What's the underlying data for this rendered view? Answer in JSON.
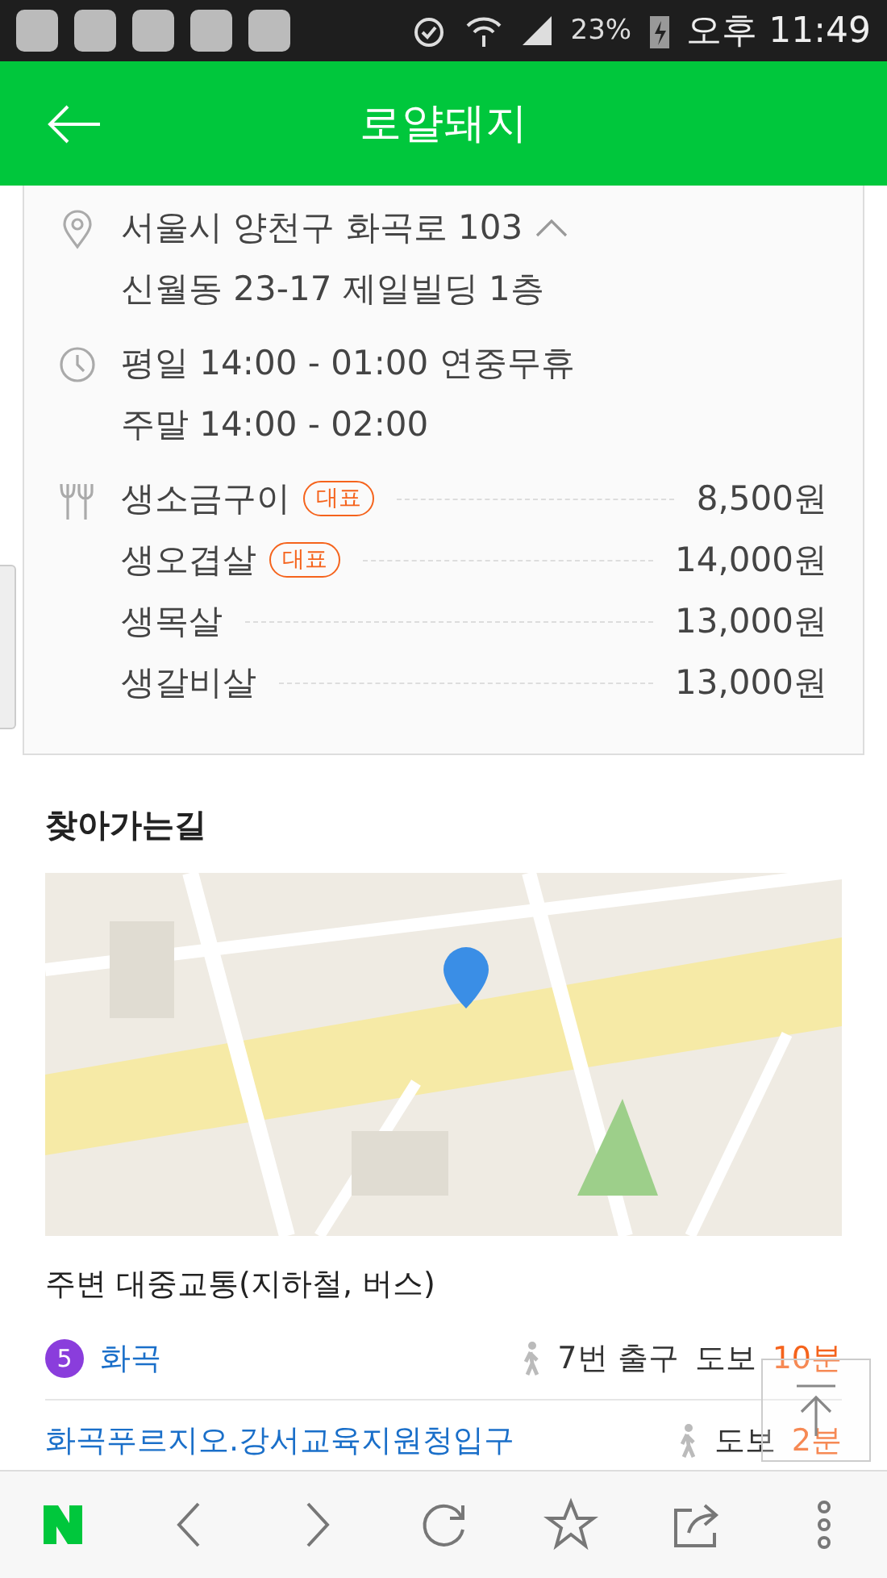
{
  "status_bar": {
    "battery": "23%",
    "time": "오후 11:49"
  },
  "header": {
    "title": "로얄돼지"
  },
  "info": {
    "address": {
      "line1": "서울시 양천구 화곡로 103",
      "line2": "신월동 23-17 제일빌딩 1층",
      "expanded": true
    },
    "hours": [
      "평일 14:00 - 01:00 연중무휴",
      "주말 14:00 - 02:00"
    ],
    "menu": [
      {
        "name": "생소금구이",
        "badge": "대표",
        "price": "8,500원"
      },
      {
        "name": "생오겹살",
        "badge": "대표",
        "price": "14,000원"
      },
      {
        "name": "생목살",
        "price": "13,000원"
      },
      {
        "name": "생갈비살",
        "price": "13,000원"
      }
    ]
  },
  "directions": {
    "title": "찾아가는길"
  },
  "transit": {
    "title": "주변 대중교통(지하철, 버스)",
    "rows": [
      {
        "kind": "subway",
        "line": "5",
        "color": "#8a3ddc",
        "name": "화곡",
        "exit": "7번 출구",
        "walk": "도보",
        "minutes": "10분"
      },
      {
        "kind": "bus",
        "name": "화곡푸르지오.강서교육지원청입구",
        "walk": "도보",
        "minutes": "2분"
      }
    ]
  }
}
